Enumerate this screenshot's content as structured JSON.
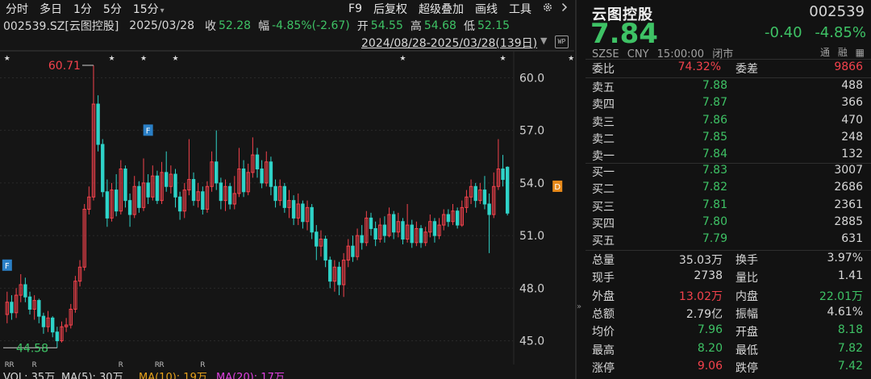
{
  "toolbar": {
    "items": [
      "分时",
      "多日",
      "1分",
      "5分",
      "15分",
      "F9",
      "后复权",
      "超级叠加",
      "画线",
      "工具"
    ],
    "dropdown_glyph": "▾",
    "settings_icon": "gear-icon",
    "next_icon": "chevron-right-icon"
  },
  "info": {
    "code": "002539.SZ[云图控股]",
    "date": "2025/03/28",
    "close_label": "收",
    "close": "52.28",
    "amp_label": "幅",
    "amp": "-4.85%(-2.67)",
    "open_label": "开",
    "open": "54.55",
    "high_label": "高",
    "high": "54.68",
    "low_label": "低",
    "low": "52.15"
  },
  "range": {
    "text": "2024/08/28-2025/03/28(139日)",
    "wp_label": "WP"
  },
  "chart": {
    "max_label": "60.71",
    "min_label": "44.58",
    "volume_line": [
      "VOL: 35万",
      "MA(5): 30万",
      "MA(10): 19万",
      "MA(20): 17万"
    ],
    "colors": {
      "up": "#f4424c",
      "down": "#2fd3c8",
      "grid": "#2a2a2a",
      "axis_text": "#d0d0d0",
      "f_tag": "#2a7fc6",
      "d_tag": "#e88a1a"
    }
  },
  "chart_data": {
    "type": "candlestick",
    "yticks": [
      "60.0",
      "57.0",
      "54.0",
      "51.0",
      "48.0",
      "45.0"
    ],
    "ylim": [
      44.2,
      61.4
    ],
    "points": [
      {
        "o": 46.5,
        "c": 47.2,
        "h": 47.8,
        "l": 46.0
      },
      {
        "o": 47.2,
        "c": 46.6,
        "h": 47.6,
        "l": 46.2
      },
      {
        "o": 46.6,
        "c": 47.6,
        "h": 48.0,
        "l": 46.3
      },
      {
        "o": 47.6,
        "c": 48.2,
        "h": 48.8,
        "l": 47.2
      },
      {
        "o": 48.2,
        "c": 47.5,
        "h": 48.6,
        "l": 47.2
      },
      {
        "o": 47.5,
        "c": 46.8,
        "h": 47.8,
        "l": 46.5
      },
      {
        "o": 46.8,
        "c": 47.3,
        "h": 47.6,
        "l": 46.2
      },
      {
        "o": 47.3,
        "c": 46.4,
        "h": 47.4,
        "l": 46.0
      },
      {
        "o": 46.4,
        "c": 45.8,
        "h": 46.6,
        "l": 45.4
      },
      {
        "o": 45.8,
        "c": 46.3,
        "h": 46.7,
        "l": 45.5
      },
      {
        "o": 46.3,
        "c": 45.5,
        "h": 46.4,
        "l": 45.2
      },
      {
        "o": 45.5,
        "c": 45.0,
        "h": 45.8,
        "l": 44.6
      },
      {
        "o": 45.0,
        "c": 45.8,
        "h": 46.1,
        "l": 44.9
      },
      {
        "o": 45.8,
        "c": 45.9,
        "h": 46.3,
        "l": 45.5
      },
      {
        "o": 45.9,
        "c": 46.8,
        "h": 47.1,
        "l": 45.7
      },
      {
        "o": 46.8,
        "c": 48.4,
        "h": 48.7,
        "l": 46.6
      },
      {
        "o": 48.4,
        "c": 49.2,
        "h": 49.6,
        "l": 48.1
      },
      {
        "o": 49.2,
        "c": 52.5,
        "h": 52.8,
        "l": 49.0
      },
      {
        "o": 52.5,
        "c": 53.2,
        "h": 53.8,
        "l": 52.2
      },
      {
        "o": 53.2,
        "c": 58.5,
        "h": 60.71,
        "l": 53.0
      },
      {
        "o": 58.5,
        "c": 56.2,
        "h": 59.0,
        "l": 55.8
      },
      {
        "o": 56.2,
        "c": 53.5,
        "h": 56.5,
        "l": 53.2
      },
      {
        "o": 53.5,
        "c": 52.0,
        "h": 54.2,
        "l": 51.5
      },
      {
        "o": 52.0,
        "c": 53.6,
        "h": 54.0,
        "l": 51.8
      },
      {
        "o": 53.6,
        "c": 52.4,
        "h": 54.5,
        "l": 52.1
      },
      {
        "o": 52.4,
        "c": 54.8,
        "h": 55.3,
        "l": 52.2
      },
      {
        "o": 54.8,
        "c": 53.0,
        "h": 55.0,
        "l": 52.6
      },
      {
        "o": 53.0,
        "c": 52.2,
        "h": 53.4,
        "l": 51.5
      },
      {
        "o": 52.2,
        "c": 53.8,
        "h": 54.4,
        "l": 52.0
      },
      {
        "o": 53.8,
        "c": 52.6,
        "h": 54.1,
        "l": 52.3
      },
      {
        "o": 52.6,
        "c": 54.0,
        "h": 55.4,
        "l": 52.4
      },
      {
        "o": 54.0,
        "c": 53.2,
        "h": 54.5,
        "l": 52.8
      },
      {
        "o": 53.2,
        "c": 54.4,
        "h": 55.0,
        "l": 53.0
      },
      {
        "o": 54.4,
        "c": 53.0,
        "h": 54.7,
        "l": 52.8
      },
      {
        "o": 53.0,
        "c": 54.6,
        "h": 55.2,
        "l": 52.8
      },
      {
        "o": 54.6,
        "c": 53.8,
        "h": 55.8,
        "l": 53.5
      },
      {
        "o": 53.8,
        "c": 54.5,
        "h": 55.0,
        "l": 53.4
      },
      {
        "o": 54.5,
        "c": 53.2,
        "h": 54.8,
        "l": 52.6
      },
      {
        "o": 53.2,
        "c": 52.4,
        "h": 53.5,
        "l": 51.9
      },
      {
        "o": 52.4,
        "c": 53.6,
        "h": 54.0,
        "l": 52.0
      },
      {
        "o": 53.6,
        "c": 54.2,
        "h": 56.5,
        "l": 53.3
      },
      {
        "o": 54.2,
        "c": 53.0,
        "h": 54.6,
        "l": 52.7
      },
      {
        "o": 53.0,
        "c": 53.5,
        "h": 54.0,
        "l": 52.6
      },
      {
        "o": 53.5,
        "c": 52.5,
        "h": 53.8,
        "l": 52.2
      },
      {
        "o": 52.5,
        "c": 53.8,
        "h": 54.1,
        "l": 52.3
      },
      {
        "o": 53.8,
        "c": 55.2,
        "h": 55.8,
        "l": 53.5
      },
      {
        "o": 55.2,
        "c": 54.0,
        "h": 57.0,
        "l": 53.6
      },
      {
        "o": 54.0,
        "c": 53.0,
        "h": 54.3,
        "l": 52.5
      },
      {
        "o": 53.0,
        "c": 53.8,
        "h": 54.2,
        "l": 52.4
      },
      {
        "o": 53.8,
        "c": 52.8,
        "h": 54.0,
        "l": 52.5
      },
      {
        "o": 52.8,
        "c": 53.4,
        "h": 54.4,
        "l": 52.5
      },
      {
        "o": 53.4,
        "c": 54.8,
        "h": 56.0,
        "l": 53.2
      },
      {
        "o": 54.8,
        "c": 53.5,
        "h": 55.3,
        "l": 53.2
      },
      {
        "o": 53.5,
        "c": 54.6,
        "h": 55.1,
        "l": 53.3
      },
      {
        "o": 54.6,
        "c": 55.6,
        "h": 56.6,
        "l": 54.3
      },
      {
        "o": 55.6,
        "c": 54.8,
        "h": 56.0,
        "l": 54.3
      },
      {
        "o": 54.8,
        "c": 54.0,
        "h": 55.3,
        "l": 53.7
      },
      {
        "o": 54.0,
        "c": 55.2,
        "h": 55.8,
        "l": 53.8
      },
      {
        "o": 55.2,
        "c": 53.8,
        "h": 55.5,
        "l": 53.3
      },
      {
        "o": 53.8,
        "c": 53.0,
        "h": 54.2,
        "l": 52.6
      },
      {
        "o": 53.0,
        "c": 53.8,
        "h": 54.2,
        "l": 52.7
      },
      {
        "o": 53.8,
        "c": 52.6,
        "h": 54.0,
        "l": 52.3
      },
      {
        "o": 52.6,
        "c": 53.0,
        "h": 53.6,
        "l": 52.0
      },
      {
        "o": 53.0,
        "c": 52.0,
        "h": 53.3,
        "l": 51.6
      },
      {
        "o": 52.0,
        "c": 52.8,
        "h": 53.4,
        "l": 51.6
      },
      {
        "o": 52.8,
        "c": 51.8,
        "h": 53.0,
        "l": 51.4
      },
      {
        "o": 51.8,
        "c": 52.6,
        "h": 53.0,
        "l": 51.3
      },
      {
        "o": 52.6,
        "c": 51.2,
        "h": 52.8,
        "l": 50.8
      },
      {
        "o": 51.2,
        "c": 50.4,
        "h": 51.6,
        "l": 49.6
      },
      {
        "o": 50.4,
        "c": 50.8,
        "h": 51.3,
        "l": 49.8
      },
      {
        "o": 50.8,
        "c": 49.6,
        "h": 51.0,
        "l": 49.2
      },
      {
        "o": 49.6,
        "c": 48.4,
        "h": 49.8,
        "l": 48.0
      },
      {
        "o": 48.4,
        "c": 49.2,
        "h": 49.6,
        "l": 47.8
      },
      {
        "o": 49.2,
        "c": 48.2,
        "h": 49.5,
        "l": 47.6
      },
      {
        "o": 48.2,
        "c": 49.6,
        "h": 50.0,
        "l": 47.5
      },
      {
        "o": 49.6,
        "c": 50.4,
        "h": 50.8,
        "l": 49.2
      },
      {
        "o": 50.4,
        "c": 49.8,
        "h": 51.0,
        "l": 49.5
      },
      {
        "o": 49.8,
        "c": 51.0,
        "h": 51.4,
        "l": 49.6
      },
      {
        "o": 51.0,
        "c": 50.6,
        "h": 51.6,
        "l": 50.2
      },
      {
        "o": 50.6,
        "c": 52.0,
        "h": 52.4,
        "l": 50.4
      },
      {
        "o": 52.0,
        "c": 51.4,
        "h": 52.3,
        "l": 51.0
      },
      {
        "o": 51.4,
        "c": 50.8,
        "h": 51.8,
        "l": 50.4
      },
      {
        "o": 50.8,
        "c": 51.6,
        "h": 52.0,
        "l": 50.6
      },
      {
        "o": 51.6,
        "c": 51.0,
        "h": 52.1,
        "l": 50.6
      },
      {
        "o": 51.0,
        "c": 52.2,
        "h": 52.6,
        "l": 50.9
      },
      {
        "o": 52.2,
        "c": 51.2,
        "h": 52.4,
        "l": 50.8
      },
      {
        "o": 51.2,
        "c": 51.8,
        "h": 52.3,
        "l": 50.9
      },
      {
        "o": 51.8,
        "c": 50.8,
        "h": 52.0,
        "l": 50.5
      },
      {
        "o": 50.8,
        "c": 51.6,
        "h": 52.8,
        "l": 50.6
      },
      {
        "o": 51.6,
        "c": 50.6,
        "h": 51.9,
        "l": 50.3
      },
      {
        "o": 50.6,
        "c": 51.4,
        "h": 51.8,
        "l": 50.4
      },
      {
        "o": 51.4,
        "c": 50.6,
        "h": 51.6,
        "l": 50.3
      },
      {
        "o": 50.6,
        "c": 51.2,
        "h": 51.5,
        "l": 50.4
      },
      {
        "o": 51.2,
        "c": 51.8,
        "h": 52.2,
        "l": 50.9
      },
      {
        "o": 51.8,
        "c": 51.0,
        "h": 52.0,
        "l": 50.6
      },
      {
        "o": 51.0,
        "c": 51.6,
        "h": 52.0,
        "l": 50.8
      },
      {
        "o": 51.6,
        "c": 52.2,
        "h": 52.5,
        "l": 51.3
      },
      {
        "o": 52.2,
        "c": 51.8,
        "h": 52.5,
        "l": 51.5
      },
      {
        "o": 51.8,
        "c": 52.4,
        "h": 52.8,
        "l": 51.6
      },
      {
        "o": 52.4,
        "c": 51.6,
        "h": 52.6,
        "l": 51.4
      },
      {
        "o": 51.6,
        "c": 52.6,
        "h": 53.0,
        "l": 51.5
      },
      {
        "o": 52.6,
        "c": 53.2,
        "h": 53.6,
        "l": 52.3
      },
      {
        "o": 53.2,
        "c": 53.8,
        "h": 54.2,
        "l": 52.8
      },
      {
        "o": 53.8,
        "c": 53.0,
        "h": 54.0,
        "l": 52.6
      },
      {
        "o": 53.0,
        "c": 53.6,
        "h": 54.0,
        "l": 52.8
      },
      {
        "o": 53.6,
        "c": 52.8,
        "h": 54.4,
        "l": 52.5
      },
      {
        "o": 52.8,
        "c": 52.2,
        "h": 53.4,
        "l": 50.0
      },
      {
        "o": 52.2,
        "c": 53.8,
        "h": 54.6,
        "l": 52.0
      },
      {
        "o": 53.8,
        "c": 54.8,
        "h": 56.5,
        "l": 53.6
      },
      {
        "o": 54.8,
        "c": 54.2,
        "h": 55.6,
        "l": 53.8
      },
      {
        "o": 54.9,
        "c": 52.28,
        "h": 54.95,
        "l": 52.15
      }
    ]
  },
  "quote": {
    "name": "云图控股",
    "code": "002539",
    "price": "7.84",
    "change": "-0.40",
    "change_pct": "-4.85%",
    "exchange": "SZSE",
    "currency": "CNY",
    "time": "15:00:00",
    "status": "闭市",
    "tags": [
      "通",
      "融"
    ],
    "wei_bi_label": "委比",
    "wei_bi": "74.32%",
    "wei_cha_label": "委差",
    "wei_cha": "9866",
    "asks": [
      {
        "label": "卖五",
        "price": "7.88",
        "vol": "488"
      },
      {
        "label": "卖四",
        "price": "7.87",
        "vol": "366"
      },
      {
        "label": "卖三",
        "price": "7.86",
        "vol": "470"
      },
      {
        "label": "卖二",
        "price": "7.85",
        "vol": "248"
      },
      {
        "label": "卖一",
        "price": "7.84",
        "vol": "132"
      }
    ],
    "bids": [
      {
        "label": "买一",
        "price": "7.83",
        "vol": "3007"
      },
      {
        "label": "买二",
        "price": "7.82",
        "vol": "2686"
      },
      {
        "label": "买三",
        "price": "7.81",
        "vol": "2361"
      },
      {
        "label": "买四",
        "price": "7.80",
        "vol": "2885"
      },
      {
        "label": "买五",
        "price": "7.79",
        "vol": "631"
      }
    ],
    "stats": [
      {
        "l1": "总量",
        "v1": "35.03万",
        "c1": "w",
        "l2": "换手",
        "v2": "3.97%",
        "c2": "w"
      },
      {
        "l1": "现手",
        "v1": "2738",
        "c1": "w",
        "l2": "量比",
        "v2": "1.41",
        "c2": "w"
      },
      {
        "l1": "外盘",
        "v1": "13.02万",
        "c1": "r",
        "l2": "内盘",
        "v2": "22.01万",
        "c2": "g"
      },
      {
        "l1": "总额",
        "v1": "2.79亿",
        "c1": "w",
        "l2": "振幅",
        "v2": "4.61%",
        "c2": "w"
      },
      {
        "l1": "均价",
        "v1": "7.96",
        "c1": "g",
        "l2": "开盘",
        "v2": "8.18",
        "c2": "g"
      },
      {
        "l1": "最高",
        "v1": "8.20",
        "c1": "g",
        "l2": "最低",
        "v2": "7.82",
        "c2": "g"
      },
      {
        "l1": "涨停",
        "v1": "9.06",
        "c1": "r",
        "l2": "跌停",
        "v2": "7.42",
        "c2": "g"
      }
    ]
  }
}
